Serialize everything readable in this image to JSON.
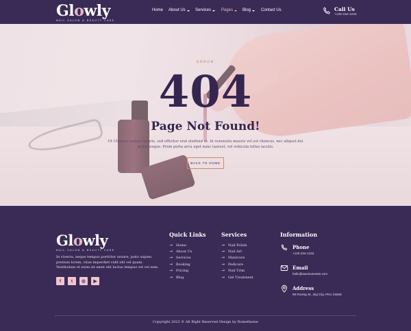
{
  "header": {
    "logo": {
      "word_pre": "Gl",
      "word_o": "o",
      "word_post": "wly",
      "tagline": "NAIL SALON & BEAUTY CARE"
    },
    "nav": [
      {
        "label": "Home",
        "has_caret": false,
        "active": false
      },
      {
        "label": "About Us",
        "has_caret": true,
        "active": false
      },
      {
        "label": "Services",
        "has_caret": true,
        "active": false
      },
      {
        "label": "Pages",
        "has_caret": true,
        "active": true
      },
      {
        "label": "Blog",
        "has_caret": true,
        "active": false
      },
      {
        "label": "Contact Us",
        "has_caret": false,
        "active": false
      }
    ],
    "call": {
      "title": "Call Us",
      "number": "+125-234-1234"
    }
  },
  "hero": {
    "error_label": "ERROR",
    "code": "404",
    "title": "Page Not Found!",
    "description": "Ut Ullamco sapien mauris, sed efficitur erat eleifend ut. In venenatis mauris vel est rhoncus, nec aliquet dui pellentesque. Proin porta arcu eget nunc laoreet, vel vehicula tellus iaculis.",
    "button_label": "BACK TO HOME"
  },
  "footer": {
    "logo": {
      "word_pre": "Gl",
      "word_o": "o",
      "word_post": "wly",
      "tagline": "NAIL SALON & BEAUTY CARE"
    },
    "about": "In viverra, neque tempus porttitor ornare, justo sapien pretium lorem, vitae imperdiet velit elit vel quam. Vestibulum et enim sit amet elit luctus tempus vel vel sem.",
    "social": [
      {
        "icon": "facebook-icon",
        "glyph": "f"
      },
      {
        "icon": "twitter-icon",
        "glyph": "t"
      },
      {
        "icon": "instagram-icon",
        "glyph": "◎"
      },
      {
        "icon": "youtube-icon",
        "glyph": "▶"
      }
    ],
    "quick_links": {
      "title": "Quick Links",
      "items": [
        "Home",
        "About Us",
        "Services",
        "Booking",
        "Pricing",
        "Blog"
      ]
    },
    "services": {
      "title": "Services",
      "items": [
        "Nail Polish",
        "Nail Art",
        "Manicure",
        "Pedicure",
        "Nail Trim",
        "Gel Treatment"
      ]
    },
    "information": {
      "title": "Information",
      "phone_title": "Phone",
      "phone": "+125-234-1234",
      "email_title": "Email",
      "email": "hello@awesomesite.com",
      "address_title": "Address",
      "address": "99 Roving St., Big City, PKU 23456"
    },
    "copyright": "Copyright 2023 © All Right Reserved Design by Rometheme"
  },
  "colors": {
    "brand_dark": "#392b56",
    "accent_pink": "#e7b7c5",
    "accent_copper": "#c98c67"
  }
}
